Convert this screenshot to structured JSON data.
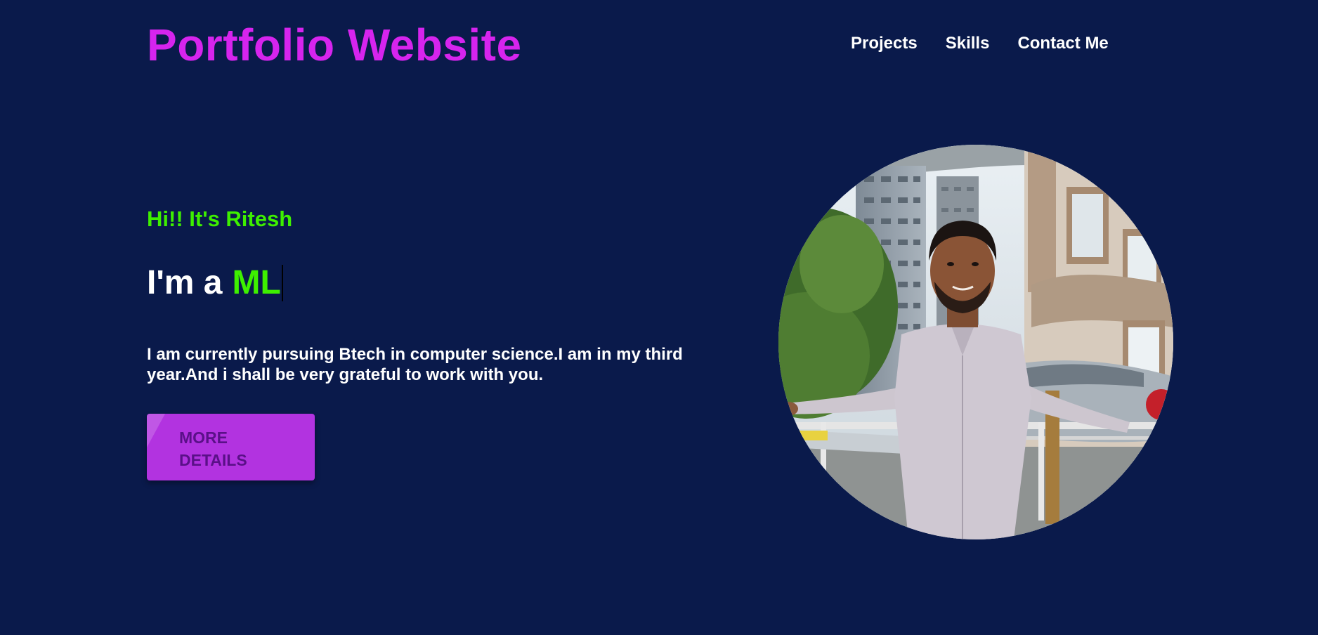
{
  "header": {
    "brand": "Portfolio Website",
    "nav": [
      "Projects",
      "Skills",
      "Contact Me"
    ]
  },
  "hero": {
    "greeting": "Hi!! It's Ritesh",
    "role_prefix": "I'm a",
    "role_typed": "ML",
    "intro": "I am currently pursuing Btech in computer science.I am in my third year.And i shall be very grateful to work with you.",
    "button_label": "MORE DETAILS"
  },
  "photo": {
    "icon": "profile-photo"
  },
  "colors": {
    "background": "#0a1a4b",
    "brand": "#d624ee",
    "accent_green": "#3ef000",
    "button": "#b233e0",
    "button_text": "#5a1088"
  }
}
